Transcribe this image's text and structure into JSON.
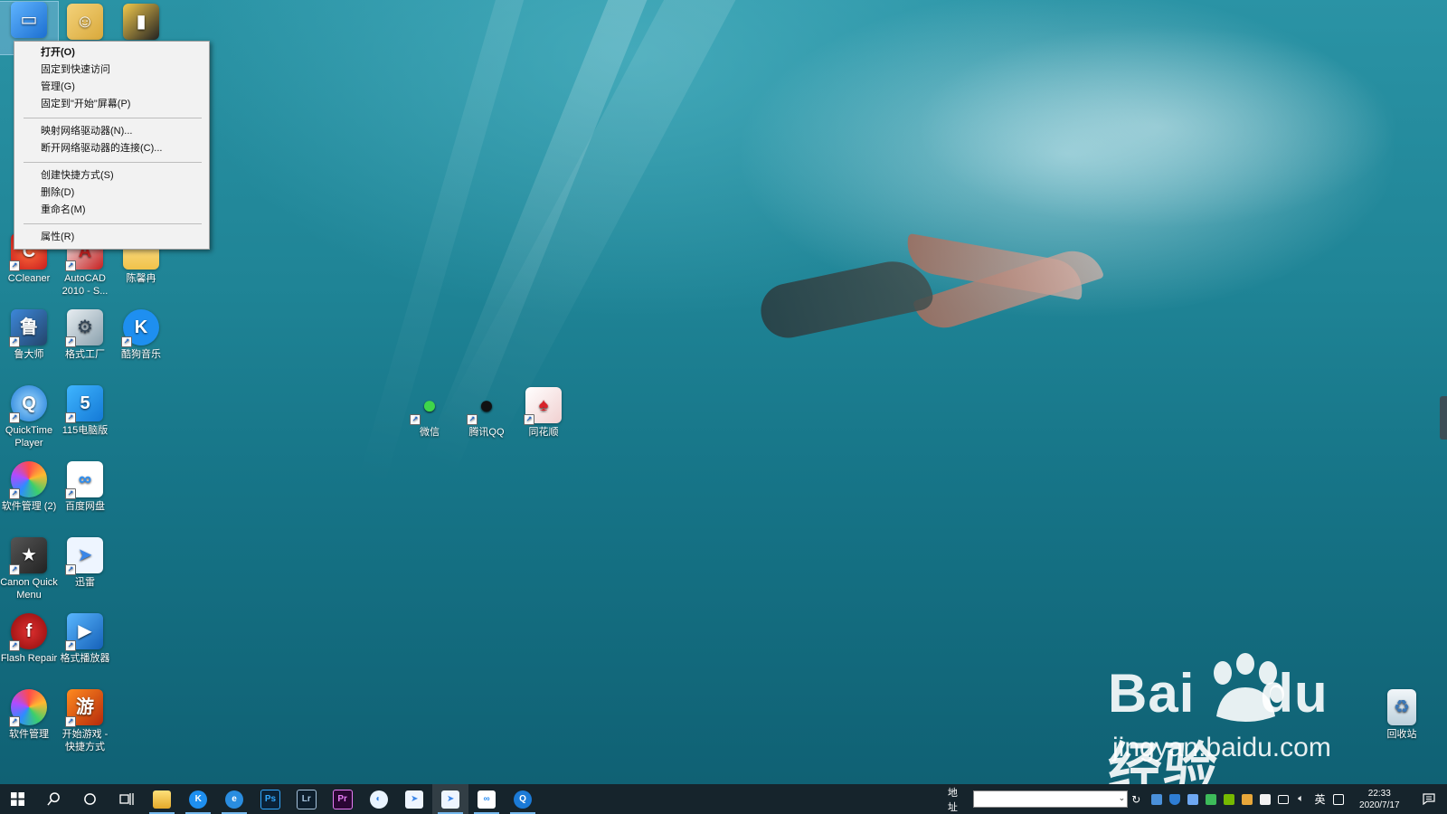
{
  "context_menu": {
    "items": [
      {
        "label": "打开(O)",
        "bold": true
      },
      {
        "label": "固定到快速访问"
      },
      {
        "label": "管理(G)"
      },
      {
        "label": "固定到\"开始\"屏幕(P)"
      },
      {
        "separator": true
      },
      {
        "label": "映射网络驱动器(N)..."
      },
      {
        "label": "断开网络驱动器的连接(C)..."
      },
      {
        "separator": true
      },
      {
        "label": "创建快捷方式(S)"
      },
      {
        "label": "删除(D)"
      },
      {
        "label": "重命名(M)"
      },
      {
        "separator": true
      },
      {
        "label": "属性(R)"
      }
    ]
  },
  "desktop_icons": {
    "ccleaner": "CCleaner",
    "autocad": "AutoCAD 2010 - S...",
    "folder": "陈馨冉",
    "ludashi": "鲁大师",
    "format_factory": "格式工厂",
    "kugou": "酷狗音乐",
    "quicktime": "QuickTime Player",
    "pc115": "115电脑版",
    "soft_mgr2": "软件管理 (2)",
    "baidu_pan": "百度网盘",
    "canon": "Canon Quick Menu",
    "xunlei": "迅雷",
    "flash_repair": "Flash Repair",
    "format_player": "格式播放器",
    "soft_mgr": "软件管理",
    "game": "开始游戏 - 快捷方式",
    "wechat": "微信",
    "qq": "腾讯QQ",
    "tonghuashun": "同花顺",
    "recycle_bin": "回收站"
  },
  "watermark": {
    "brand_left": "Bai",
    "brand_mid": "du",
    "brand_right": "经验",
    "url": "jingyan.baidu.com"
  },
  "taskbar": {
    "address_label": "地址",
    "address_value": "",
    "ime": "英",
    "time": "22:33",
    "date": "2020/7/17"
  },
  "colors": {
    "taskbar": "#16242c",
    "menu_bg": "#f2f2f2",
    "accent": "#76b9ed"
  }
}
